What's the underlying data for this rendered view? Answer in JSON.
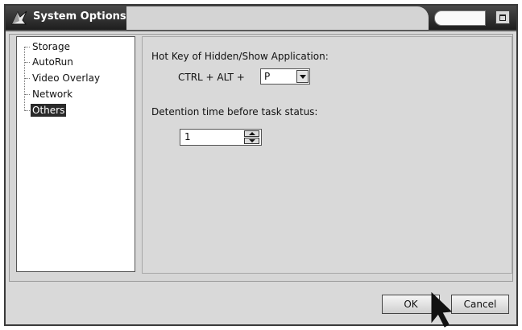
{
  "window": {
    "title": "System Options",
    "icons": {
      "app": "app-icon",
      "maximize": "maximize-icon"
    }
  },
  "sidebar": {
    "items": [
      {
        "label": "Storage",
        "selected": false
      },
      {
        "label": "AutoRun",
        "selected": false
      },
      {
        "label": "Video Overlay",
        "selected": false
      },
      {
        "label": "Network",
        "selected": false
      },
      {
        "label": "Others",
        "selected": true
      }
    ]
  },
  "panel": {
    "hotkey_label": "Hot Key of Hidden/Show Application:",
    "hotkey_prefix": "CTRL + ALT +",
    "hotkey_value": "P",
    "detention_label": "Detention time before task status:",
    "detention_value": "1"
  },
  "buttons": {
    "ok": "OK",
    "cancel": "Cancel"
  },
  "colors": {
    "titlebar": "#2a2a2a",
    "window_bg": "#d9d9d9",
    "selection": "#2a2a2a"
  }
}
